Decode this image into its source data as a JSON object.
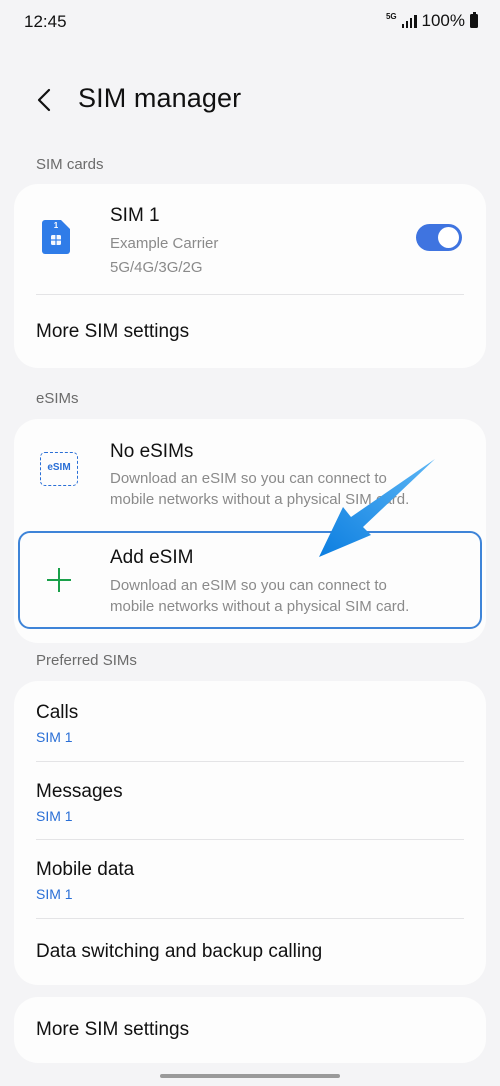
{
  "status_bar": {
    "time": "12:45",
    "network_badge": "5G",
    "battery_text": "100%"
  },
  "header": {
    "title": "SIM manager"
  },
  "sim_cards": {
    "section_label": "SIM cards",
    "sim1": {
      "badge": "1",
      "name": "SIM 1",
      "carrier": "Example Carrier",
      "networks": "5G/4G/3G/2G",
      "enabled": true
    },
    "more_settings": "More SIM settings"
  },
  "esims": {
    "section_label": "eSIMs",
    "no_esims": {
      "icon_text": "eSIM",
      "title": "No eSIMs",
      "desc_line1": "Download an eSIM so you can connect to",
      "desc_line2": "mobile networks without a physical SIM card."
    },
    "add_esim": {
      "title": "Add eSIM",
      "desc_line1": "Download an eSIM so you can connect to",
      "desc_line2": "mobile networks without a physical SIM card."
    }
  },
  "preferred": {
    "section_label": "Preferred SIMs",
    "items": [
      {
        "title": "Calls",
        "value": "SIM 1"
      },
      {
        "title": "Messages",
        "value": "SIM 1"
      },
      {
        "title": "Mobile data",
        "value": "SIM 1"
      },
      {
        "title": "Data switching and backup calling"
      }
    ]
  },
  "bottom": {
    "more_settings": "More SIM settings"
  },
  "colors": {
    "accent": "#3f74e0",
    "highlight_border": "#3e84d8",
    "arrow": "#1a8ee8",
    "plus": "#1aa04a"
  },
  "icons": [
    "back-icon",
    "sim-card-icon",
    "esim-icon",
    "plus-icon",
    "annotation-arrow-icon"
  ]
}
